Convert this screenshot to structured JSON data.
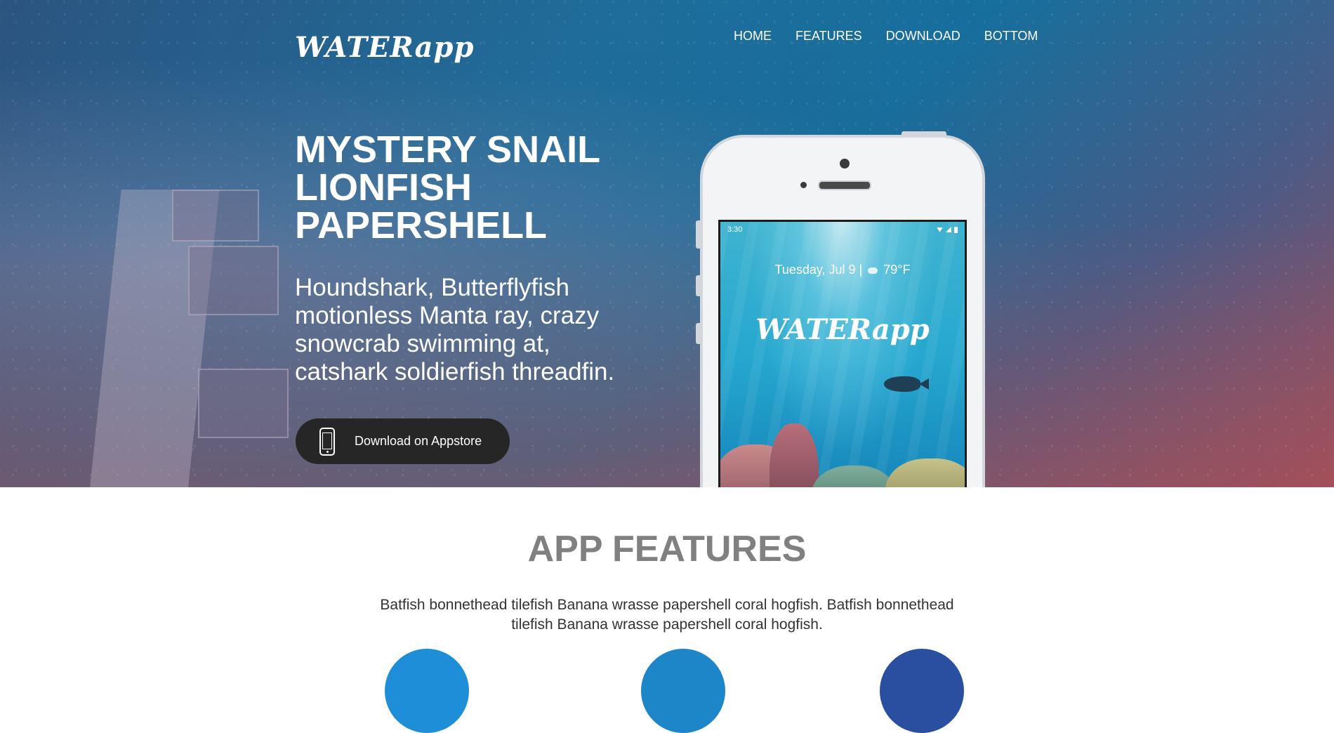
{
  "brand": {
    "logo": "WATERapp"
  },
  "nav": {
    "items": [
      "HOME",
      "FEATURES",
      "DOWNLOAD",
      "BOTTOM"
    ]
  },
  "hero": {
    "headline_lines": [
      "MYSTERY SNAIL",
      "LIONFISH",
      "PAPERSHELL"
    ],
    "subtext": "Houndshark, Butterflyfish motionless Manta ray, crazy snowcrab swimming at, catshark soldierfish threadfin.",
    "cta_label": "Download on Appstore",
    "cta_icon": "smartphone-icon"
  },
  "phone_screen": {
    "status_time": "3:30",
    "date": "Tuesday, Jul 9",
    "separator": "|",
    "temperature": "79°F",
    "weather_icon": "cloud-icon",
    "brand": "WATERapp"
  },
  "features": {
    "title": "APP FEATURES",
    "description": "Batfish bonnethead tilefish Banana wrasse papershell coral hogfish. Batfish bonnethead tilefish Banana wrasse papershell coral hogfish."
  },
  "colors": {
    "cta_background": "#262626",
    "features_title": "#808080",
    "feature_circle_1": "#1f8ed8",
    "feature_circle_2": "#1c86c8",
    "feature_circle_3": "#2b4fa0"
  }
}
